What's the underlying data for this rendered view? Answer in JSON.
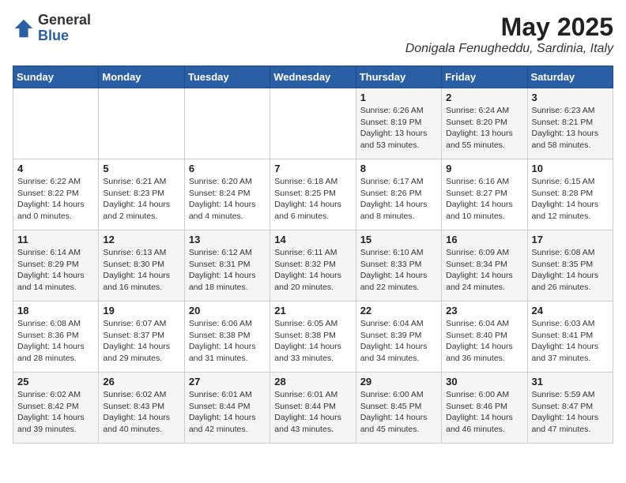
{
  "logo": {
    "general": "General",
    "blue": "Blue"
  },
  "title": {
    "month_year": "May 2025",
    "location": "Donigala Fenugheddu, Sardinia, Italy"
  },
  "days_of_week": [
    "Sunday",
    "Monday",
    "Tuesday",
    "Wednesday",
    "Thursday",
    "Friday",
    "Saturday"
  ],
  "weeks": [
    [
      {
        "day": "",
        "info": ""
      },
      {
        "day": "",
        "info": ""
      },
      {
        "day": "",
        "info": ""
      },
      {
        "day": "",
        "info": ""
      },
      {
        "day": "1",
        "info": "Sunrise: 6:26 AM\nSunset: 8:19 PM\nDaylight: 13 hours\nand 53 minutes."
      },
      {
        "day": "2",
        "info": "Sunrise: 6:24 AM\nSunset: 8:20 PM\nDaylight: 13 hours\nand 55 minutes."
      },
      {
        "day": "3",
        "info": "Sunrise: 6:23 AM\nSunset: 8:21 PM\nDaylight: 13 hours\nand 58 minutes."
      }
    ],
    [
      {
        "day": "4",
        "info": "Sunrise: 6:22 AM\nSunset: 8:22 PM\nDaylight: 14 hours\nand 0 minutes."
      },
      {
        "day": "5",
        "info": "Sunrise: 6:21 AM\nSunset: 8:23 PM\nDaylight: 14 hours\nand 2 minutes."
      },
      {
        "day": "6",
        "info": "Sunrise: 6:20 AM\nSunset: 8:24 PM\nDaylight: 14 hours\nand 4 minutes."
      },
      {
        "day": "7",
        "info": "Sunrise: 6:18 AM\nSunset: 8:25 PM\nDaylight: 14 hours\nand 6 minutes."
      },
      {
        "day": "8",
        "info": "Sunrise: 6:17 AM\nSunset: 8:26 PM\nDaylight: 14 hours\nand 8 minutes."
      },
      {
        "day": "9",
        "info": "Sunrise: 6:16 AM\nSunset: 8:27 PM\nDaylight: 14 hours\nand 10 minutes."
      },
      {
        "day": "10",
        "info": "Sunrise: 6:15 AM\nSunset: 8:28 PM\nDaylight: 14 hours\nand 12 minutes."
      }
    ],
    [
      {
        "day": "11",
        "info": "Sunrise: 6:14 AM\nSunset: 8:29 PM\nDaylight: 14 hours\nand 14 minutes."
      },
      {
        "day": "12",
        "info": "Sunrise: 6:13 AM\nSunset: 8:30 PM\nDaylight: 14 hours\nand 16 minutes."
      },
      {
        "day": "13",
        "info": "Sunrise: 6:12 AM\nSunset: 8:31 PM\nDaylight: 14 hours\nand 18 minutes."
      },
      {
        "day": "14",
        "info": "Sunrise: 6:11 AM\nSunset: 8:32 PM\nDaylight: 14 hours\nand 20 minutes."
      },
      {
        "day": "15",
        "info": "Sunrise: 6:10 AM\nSunset: 8:33 PM\nDaylight: 14 hours\nand 22 minutes."
      },
      {
        "day": "16",
        "info": "Sunrise: 6:09 AM\nSunset: 8:34 PM\nDaylight: 14 hours\nand 24 minutes."
      },
      {
        "day": "17",
        "info": "Sunrise: 6:08 AM\nSunset: 8:35 PM\nDaylight: 14 hours\nand 26 minutes."
      }
    ],
    [
      {
        "day": "18",
        "info": "Sunrise: 6:08 AM\nSunset: 8:36 PM\nDaylight: 14 hours\nand 28 minutes."
      },
      {
        "day": "19",
        "info": "Sunrise: 6:07 AM\nSunset: 8:37 PM\nDaylight: 14 hours\nand 29 minutes."
      },
      {
        "day": "20",
        "info": "Sunrise: 6:06 AM\nSunset: 8:38 PM\nDaylight: 14 hours\nand 31 minutes."
      },
      {
        "day": "21",
        "info": "Sunrise: 6:05 AM\nSunset: 8:38 PM\nDaylight: 14 hours\nand 33 minutes."
      },
      {
        "day": "22",
        "info": "Sunrise: 6:04 AM\nSunset: 8:39 PM\nDaylight: 14 hours\nand 34 minutes."
      },
      {
        "day": "23",
        "info": "Sunrise: 6:04 AM\nSunset: 8:40 PM\nDaylight: 14 hours\nand 36 minutes."
      },
      {
        "day": "24",
        "info": "Sunrise: 6:03 AM\nSunset: 8:41 PM\nDaylight: 14 hours\nand 37 minutes."
      }
    ],
    [
      {
        "day": "25",
        "info": "Sunrise: 6:02 AM\nSunset: 8:42 PM\nDaylight: 14 hours\nand 39 minutes."
      },
      {
        "day": "26",
        "info": "Sunrise: 6:02 AM\nSunset: 8:43 PM\nDaylight: 14 hours\nand 40 minutes."
      },
      {
        "day": "27",
        "info": "Sunrise: 6:01 AM\nSunset: 8:44 PM\nDaylight: 14 hours\nand 42 minutes."
      },
      {
        "day": "28",
        "info": "Sunrise: 6:01 AM\nSunset: 8:44 PM\nDaylight: 14 hours\nand 43 minutes."
      },
      {
        "day": "29",
        "info": "Sunrise: 6:00 AM\nSunset: 8:45 PM\nDaylight: 14 hours\nand 45 minutes."
      },
      {
        "day": "30",
        "info": "Sunrise: 6:00 AM\nSunset: 8:46 PM\nDaylight: 14 hours\nand 46 minutes."
      },
      {
        "day": "31",
        "info": "Sunrise: 5:59 AM\nSunset: 8:47 PM\nDaylight: 14 hours\nand 47 minutes."
      }
    ]
  ]
}
